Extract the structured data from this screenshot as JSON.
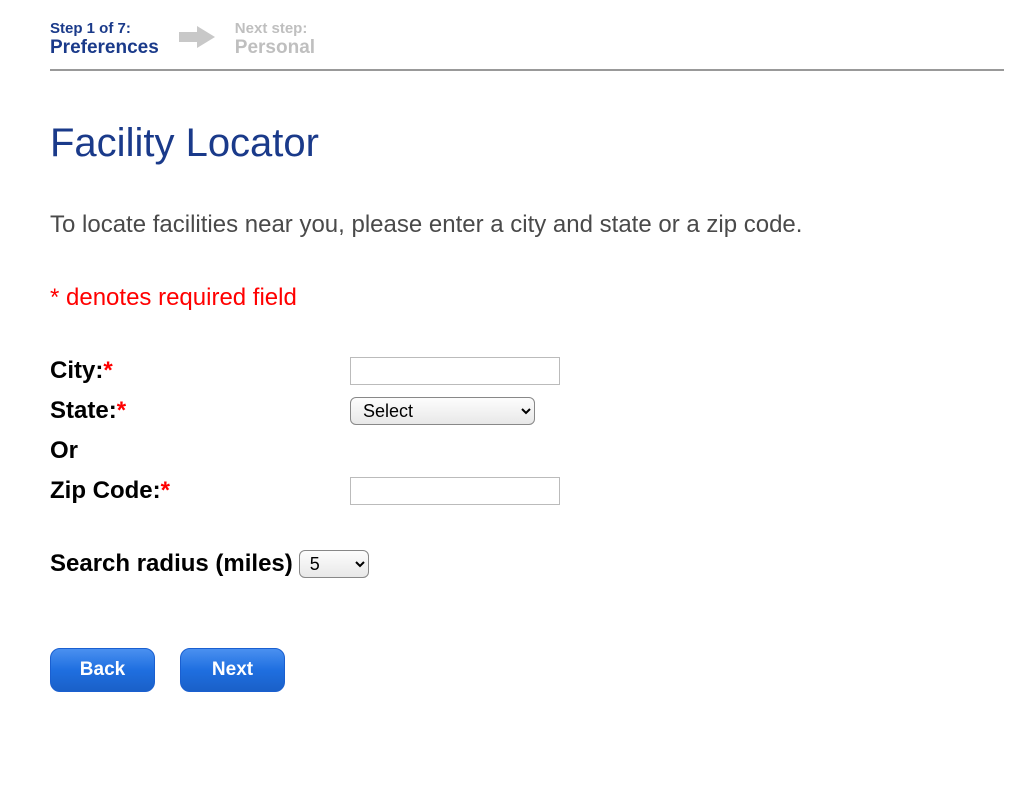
{
  "stepper": {
    "current_small": "Step 1 of 7:",
    "current_big": "Preferences",
    "next_small": "Next step:",
    "next_big": "Personal"
  },
  "heading": "Facility Locator",
  "instructions": "To locate facilities near you, please enter a city and state or a zip code.",
  "required_note": "* denotes required field",
  "form": {
    "city_label": "City:",
    "city_value": "",
    "state_label": "State:",
    "state_selected": "Select",
    "or_label": "Or",
    "zip_label": "Zip Code:",
    "zip_value": "",
    "radius_label": "Search radius (miles)",
    "radius_selected": "5"
  },
  "buttons": {
    "back": "Back",
    "next": "Next"
  }
}
